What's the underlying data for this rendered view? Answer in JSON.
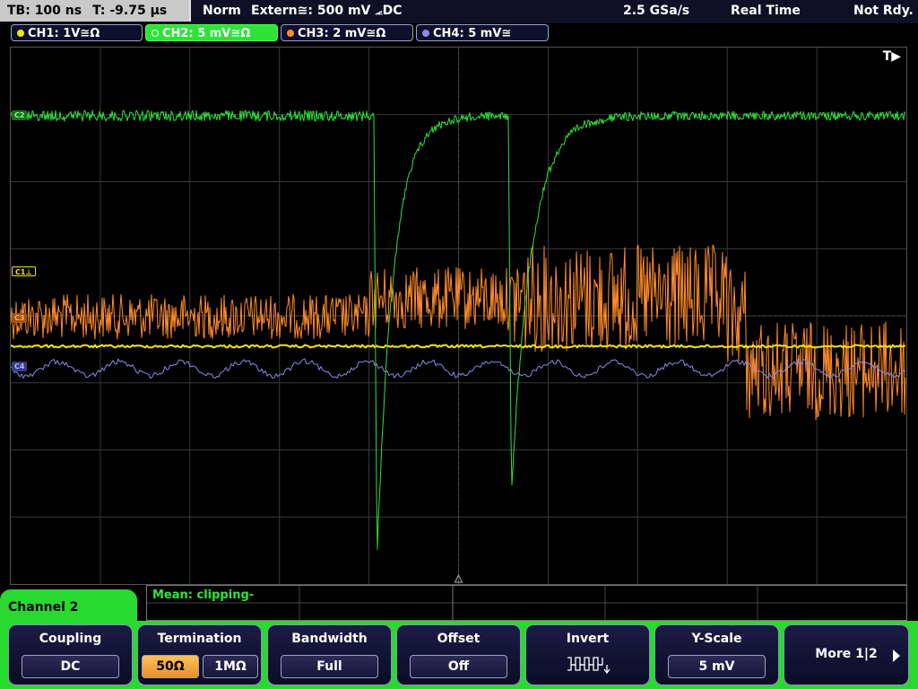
{
  "status_bar": {
    "timebase": "TB: 100 ns",
    "trigger_time": "T: -9.75 µs",
    "mode": "Norm",
    "trigger_source": "Extern≅: 500 mV ⦟DC",
    "sample_rate": "2.5 GSa/s",
    "acq_mode": "Real Time",
    "ready_state": "Not Rdy."
  },
  "channels": [
    {
      "label": "CH1: 1V≅Ω",
      "color": "#f5e600"
    },
    {
      "label": "CH2: 5 mV≅Ω",
      "color": "#2ee23a"
    },
    {
      "label": "CH3: 2 mV≅Ω",
      "color": "#ff8c2a"
    },
    {
      "label": "CH4: 5 mV≅",
      "color": "#8a8ae8"
    }
  ],
  "screen": {
    "trigger_marker": "T▶",
    "markers": {
      "c1": "C1⊥",
      "c2": "C2",
      "c3": "C3",
      "c4": "C4"
    },
    "grid_color": "#3a3a3a"
  },
  "measurement": {
    "text": "Mean: clipping-"
  },
  "active_channel_tab": "Channel 2",
  "softkeys": {
    "coupling": {
      "title": "Coupling",
      "value": "DC"
    },
    "termination": {
      "title": "Termination",
      "opt1": "50Ω",
      "opt2": "1MΩ",
      "selected": "50Ω"
    },
    "bandwidth": {
      "title": "Bandwidth",
      "value": "Full"
    },
    "offset": {
      "title": "Offset",
      "value": "Off"
    },
    "invert": {
      "title": "Invert"
    },
    "y_scale": {
      "title": "Y-Scale",
      "value": "5 mV"
    },
    "more": {
      "label": "More 1|2"
    }
  },
  "traces": {
    "ch2_color": "#2ee23a",
    "ch3_color": "#ff8c2a",
    "ch1_color": "#f5e600",
    "ch4_color": "#8a8ae8"
  }
}
